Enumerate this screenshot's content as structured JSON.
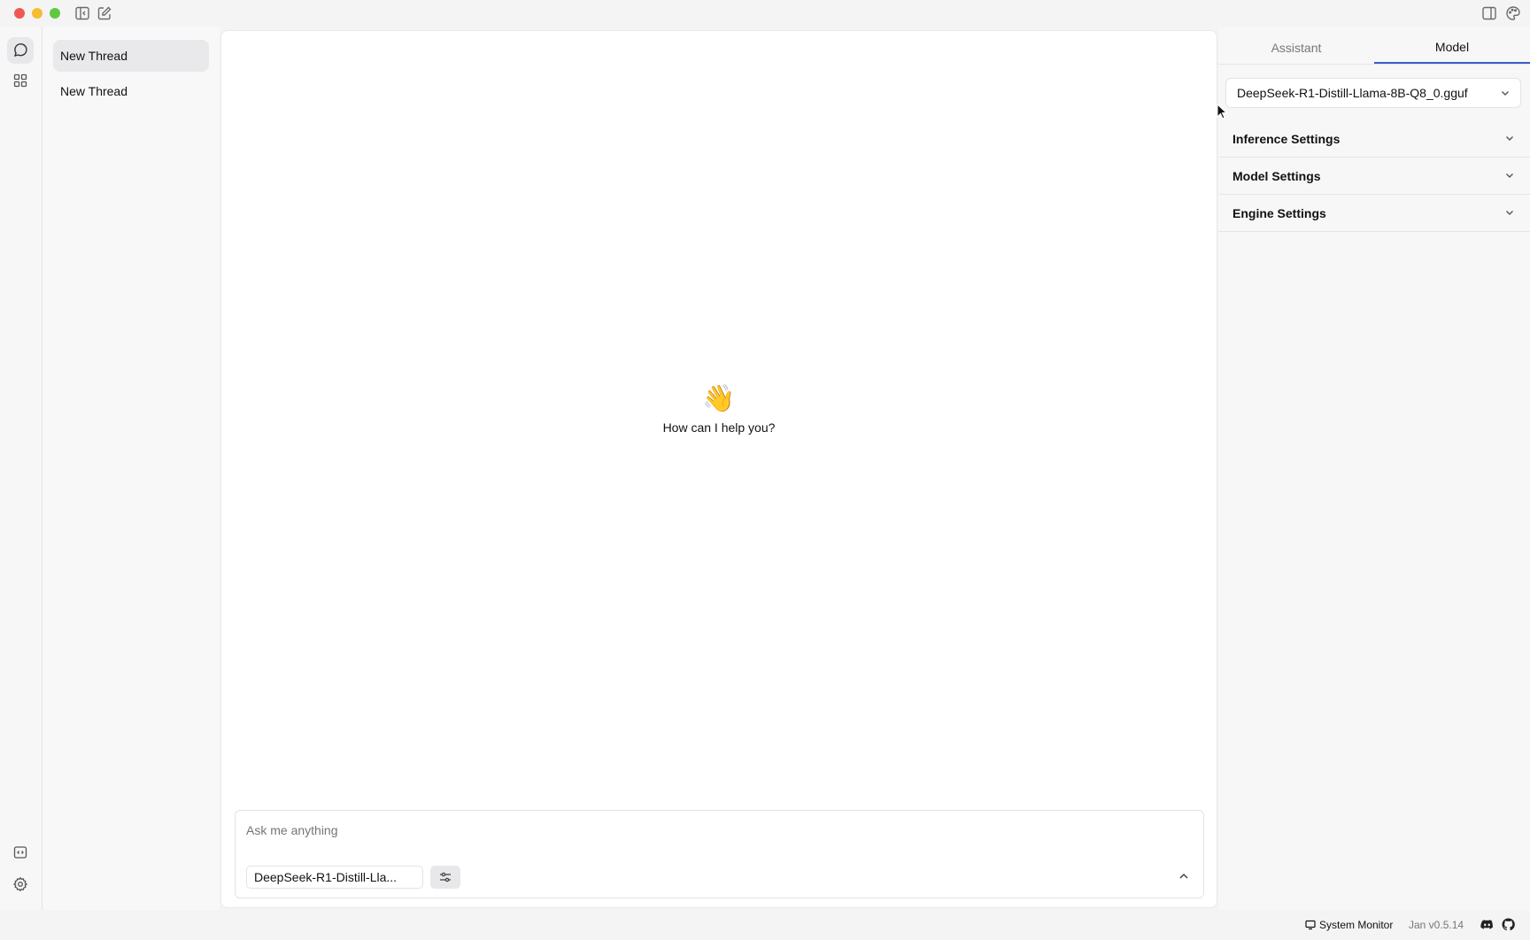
{
  "threads": {
    "items": [
      {
        "label": "New Thread",
        "active": true
      },
      {
        "label": "New Thread",
        "active": false
      }
    ]
  },
  "main": {
    "emoji": "👋",
    "welcome": "How can I help you?",
    "composer": {
      "placeholder": "Ask me anything",
      "model_chip": "DeepSeek-R1-Distill-Lla..."
    }
  },
  "right_panel": {
    "tabs": [
      {
        "label": "Assistant",
        "active": false
      },
      {
        "label": "Model",
        "active": true
      }
    ],
    "model_select": "DeepSeek-R1-Distill-Llama-8B-Q8_0.gguf",
    "sections": [
      "Inference Settings",
      "Model Settings",
      "Engine Settings"
    ]
  },
  "status_bar": {
    "system_monitor": "System Monitor",
    "version": "Jan v0.5.14"
  },
  "colors": {
    "accent": "#3b5cc6",
    "close": "#ee5a52",
    "minimize": "#f5bd2f",
    "maximize": "#5fc83f"
  }
}
